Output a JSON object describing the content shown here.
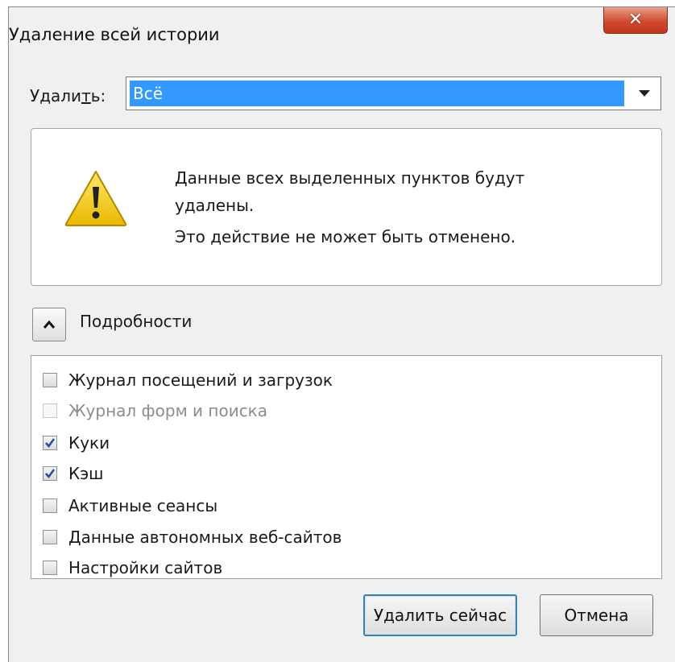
{
  "window": {
    "title": "Удаление всей истории"
  },
  "delete_range": {
    "label_before": "Удали",
    "label_access": "т",
    "label_after": "ь:",
    "selected": "Всё"
  },
  "warning": {
    "line1": "Данные всех выделенных пунктов будут удалены.",
    "line2": "Это действие не может быть отменено."
  },
  "details": {
    "label": "Подробности"
  },
  "items": [
    {
      "label": "Журнал посещений и загрузок",
      "checked": false,
      "disabled": false
    },
    {
      "label": "Журнал форм и поиска",
      "checked": false,
      "disabled": true
    },
    {
      "label": "Куки",
      "checked": true,
      "disabled": false
    },
    {
      "label": "Кэш",
      "checked": true,
      "disabled": false
    },
    {
      "label": "Активные сеансы",
      "checked": false,
      "disabled": false
    },
    {
      "label": "Данные автономных веб-сайтов",
      "checked": false,
      "disabled": false
    },
    {
      "label": "Настройки сайтов",
      "checked": false,
      "disabled": false
    }
  ],
  "buttons": {
    "clear_now": "Удалить сейчас",
    "cancel": "Отмена"
  },
  "colors": {
    "selection": "#3399ff",
    "close": "#c7422a",
    "warning": "#f3cf1b"
  }
}
